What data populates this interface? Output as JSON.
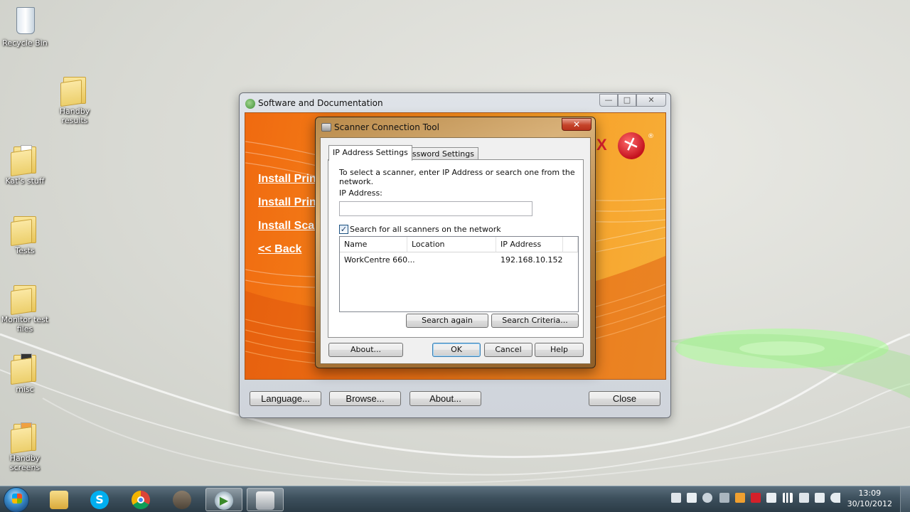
{
  "desktop": {
    "icons": [
      {
        "label": "Recycle Bin",
        "icon": "recycle-bin-icon"
      },
      {
        "label": "Handby results",
        "icon": "folder-icon"
      },
      {
        "label": "Kat's stuff",
        "icon": "folder-icon"
      },
      {
        "label": "Tests",
        "icon": "folder-icon"
      },
      {
        "label": "Monitor test files",
        "icon": "folder-icon"
      },
      {
        "label": "misc",
        "icon": "folder-icon"
      },
      {
        "label": "Handby screens",
        "icon": "folder-icon"
      }
    ]
  },
  "main_window": {
    "title": "Software and Documentation",
    "links": [
      "Install Print",
      "Install Print",
      "Install Scar",
      "<< Back"
    ],
    "logo_text": "X",
    "buttons": {
      "language": "Language...",
      "browse": "Browse...",
      "about": "About...",
      "close": "Close"
    },
    "caption_buttons": {
      "minimize": "—",
      "maximize": "□",
      "close": "✕"
    }
  },
  "dialog": {
    "title": "Scanner Connection Tool",
    "close_glyph": "✕",
    "tabs": [
      "IP Address Settings",
      "Password Settings"
    ],
    "instruction": "To select a scanner, enter IP Address or search one from the network.",
    "ip_label": "IP Address:",
    "ip_value": "",
    "search_checkbox_label": "Search for all scanners on the network",
    "search_checked": true,
    "columns": [
      "Name",
      "Location",
      "IP Address"
    ],
    "rows": [
      {
        "name": "WorkCentre 660...",
        "location": "",
        "ip": "192.168.10.152"
      }
    ],
    "buttons": {
      "search_again": "Search again",
      "search_criteria": "Search Criteria...",
      "about": "About...",
      "ok": "OK",
      "cancel": "Cancel",
      "help": "Help"
    }
  },
  "taskbar": {
    "pinned": [
      "windows-explorer-icon",
      "skype-icon",
      "chrome-icon",
      "gimp-icon",
      "media-player-icon",
      "scanner-tool-icon"
    ],
    "clock_time": "13:09",
    "clock_date": "30/10/2012"
  }
}
